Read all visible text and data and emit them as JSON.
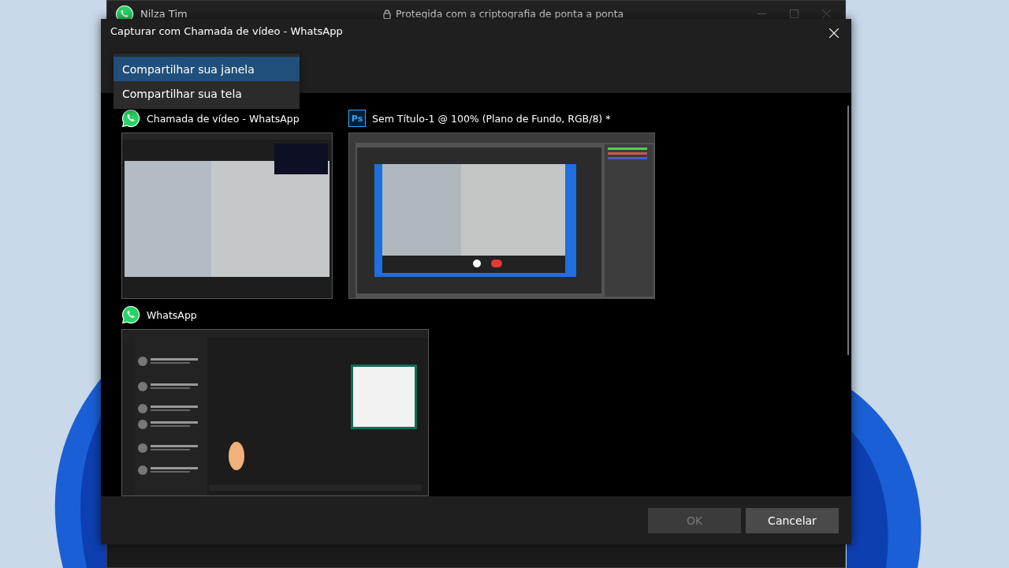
{
  "background_window": {
    "title": "Nilza Tim",
    "security_notice": "Protegida com a criptografia de ponta a ponta"
  },
  "dialog": {
    "title": "Capturar com Chamada de vídeo - WhatsApp"
  },
  "share_menu": {
    "items": [
      {
        "label": "Compartilhar sua janela",
        "selected": true
      },
      {
        "label": "Compartilhar sua tela",
        "selected": false
      }
    ]
  },
  "windows": [
    {
      "kind": "whatsapp",
      "title": "Chamada de vídeo - WhatsApp",
      "preview": {
        "kind": "video-call"
      }
    },
    {
      "kind": "photoshop",
      "icon_text": "Ps",
      "title": "Sem Título-1 @ 100% (Plano de Fundo, RGB/8) *",
      "preview": {
        "kind": "photo-editor"
      }
    },
    {
      "kind": "whatsapp",
      "title": "WhatsApp",
      "preview": {
        "kind": "chat"
      }
    }
  ],
  "buttons": [
    {
      "label": "OK",
      "disabled": true
    },
    {
      "label": "Cancelar",
      "disabled": false
    }
  ]
}
